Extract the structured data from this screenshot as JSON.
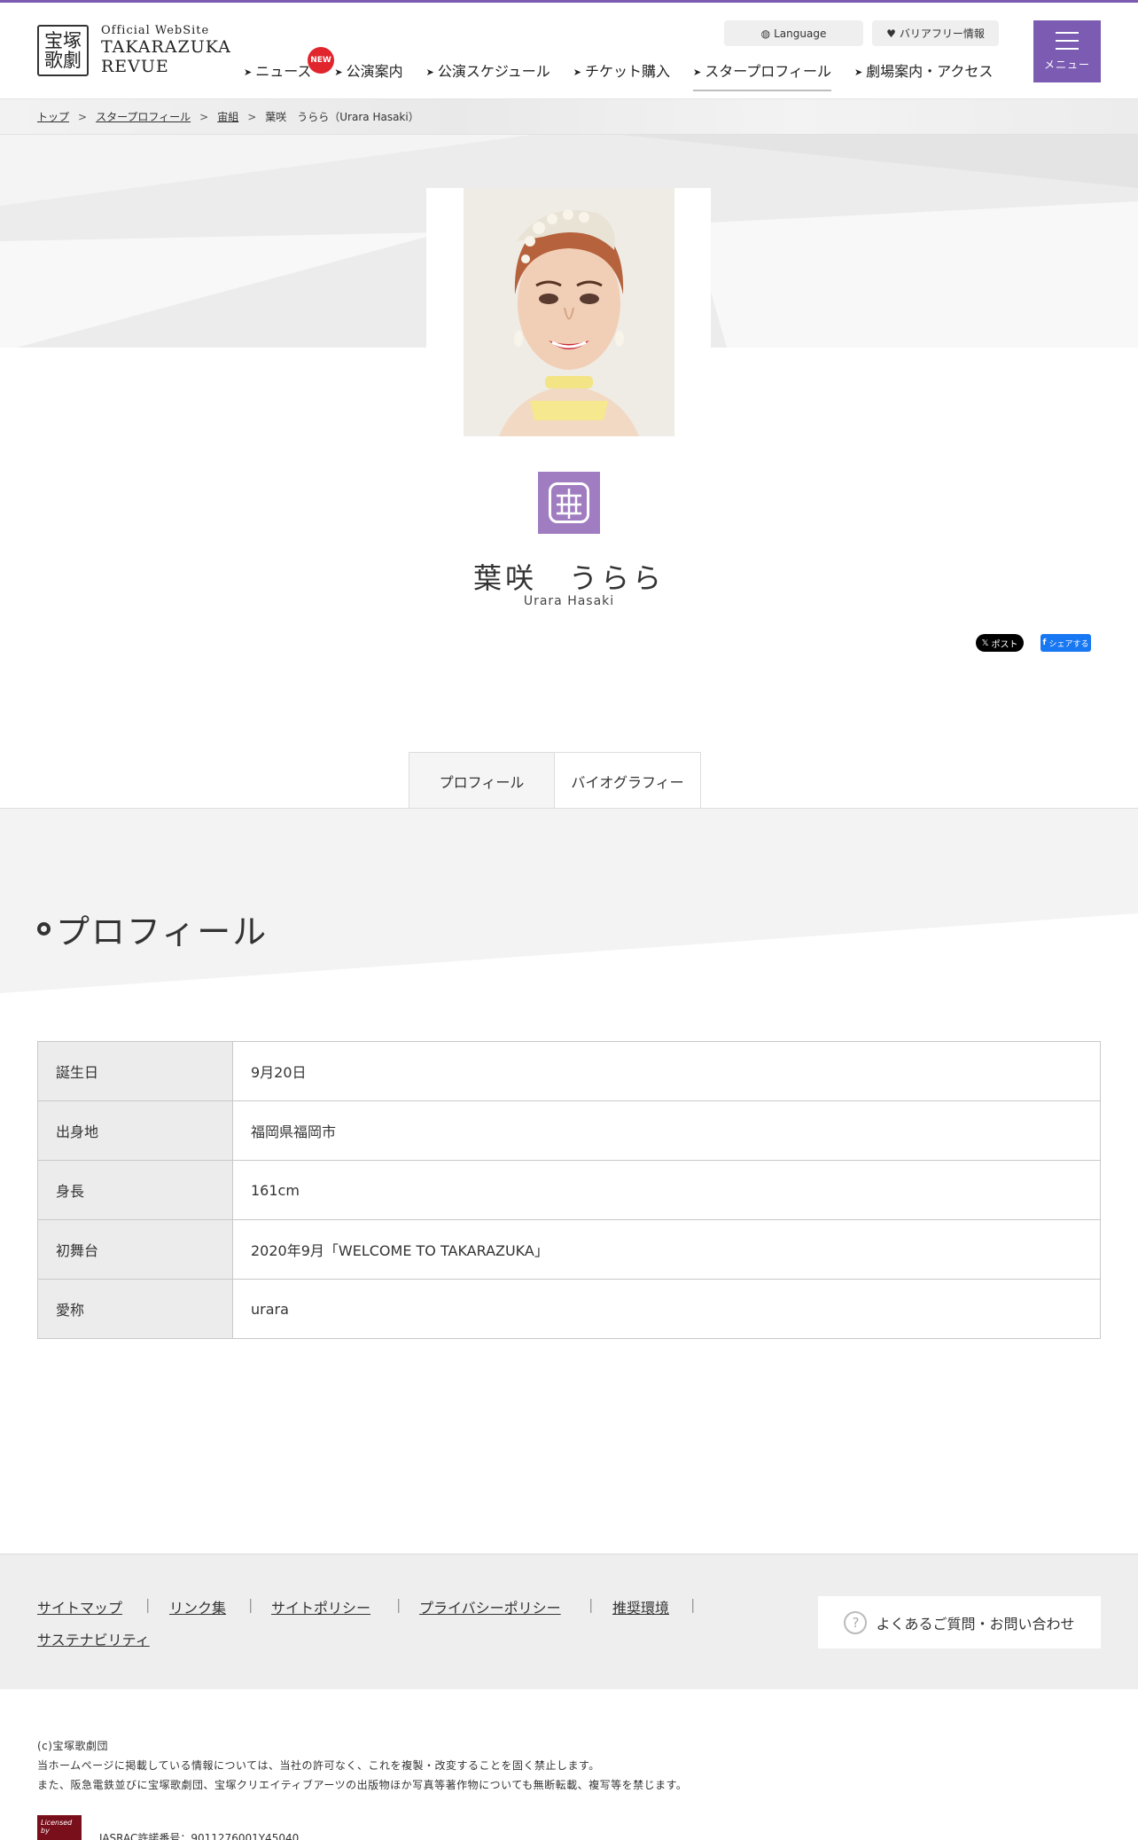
{
  "header": {
    "logo_mark": "宝塚\n歌劇",
    "logo_line1": "Official WebSite",
    "logo_line2": "TAKARAZUKA",
    "logo_line3": "REVUE",
    "language_label": "Language",
    "barrier_free_label": "バリアフリー情報",
    "menu_label": "メニュー",
    "new_badge": "NEW",
    "nav": [
      "ニュース",
      "公演案内",
      "公演スケジュール",
      "チケット購入",
      "スタープロフィール",
      "劇場案内・アクセス"
    ]
  },
  "breadcrumb": {
    "items": [
      "トップ",
      "スタープロフィール",
      "宙組"
    ],
    "current": "葉咲　うらら（Urara Hasaki）"
  },
  "star": {
    "name_ja": "葉咲　うらら",
    "name_en": "Urara Hasaki",
    "troupe_color": "#a07dc0"
  },
  "share": {
    "x_label": "ポスト",
    "fb_label": "シェアする"
  },
  "tabs": [
    "プロフィール",
    "バイオグラフィー"
  ],
  "section_title": "プロフィール",
  "profile": [
    {
      "key": "誕生日",
      "value": "9月20日"
    },
    {
      "key": "出身地",
      "value": "福岡県福岡市"
    },
    {
      "key": "身長",
      "value": "161cm"
    },
    {
      "key": "初舞台",
      "value": "2020年9月「WELCOME TO TAKARAZUKA」"
    },
    {
      "key": "愛称",
      "value": "urara"
    }
  ],
  "footer": {
    "links": [
      "サイトマップ",
      "リンク集",
      "サイトポリシー",
      "プライバシーポリシー",
      "推奨環境",
      "サステナビリティ"
    ],
    "faq_label": "よくあるご質問・お問い合わせ",
    "copyright": "(c)宝塚歌劇団",
    "notice1": "当ホームページに掲載している情報については、当社の許可なく、これを複製・改変することを固く禁止します。",
    "notice2": "また、阪急電鉄並びに宝塚歌劇団、宝塚クリエイティブアーツの出版物ほか写真等著作物についても無断転載、複写等を禁じます。",
    "jasrac_logo": "Licensed by",
    "jasrac_text": "JASRAC許諾番号：9011276001Y45040"
  },
  "colors": {
    "brand_purple": "#7b5cb2",
    "new_red": "#e0262c"
  }
}
